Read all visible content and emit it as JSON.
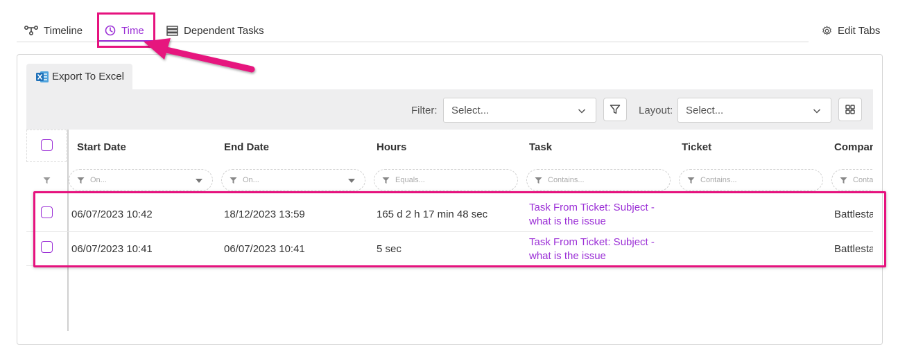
{
  "tabs": {
    "timeline": "Timeline",
    "time": "Time",
    "dependent_tasks": "Dependent Tasks",
    "edit_tabs": "Edit Tabs"
  },
  "toolbar": {
    "export_label": "Export To Excel",
    "filter_label": "Filter:",
    "filter_placeholder": "Select...",
    "layout_label": "Layout:",
    "layout_placeholder": "Select..."
  },
  "table": {
    "columns": [
      "Start Date",
      "End Date",
      "Hours",
      "Task",
      "Ticket",
      "Company"
    ],
    "filters": [
      "On...",
      "On...",
      "Equals...",
      "Contains...",
      "Contains...",
      "Contains..."
    ],
    "rows": [
      {
        "start_date": "06/07/2023 10:42",
        "end_date": "18/12/2023 13:59",
        "hours": "165 d 2 h 17 min 48 sec",
        "task_line1": "Task From Ticket: Subject -",
        "task_line2": "what is the issue",
        "ticket": "",
        "company": "Battlestar"
      },
      {
        "start_date": "06/07/2023 10:41",
        "end_date": "06/07/2023 10:41",
        "hours": "5 sec",
        "task_line1": "Task From Ticket: Subject -",
        "task_line2": "what is the issue",
        "ticket": "",
        "company": "Battlestar"
      }
    ]
  },
  "colors": {
    "accent": "#9b2fd6",
    "annotation": "#e6127e",
    "toolbar_bg": "#eeeeef"
  },
  "icons": [
    "timeline-icon",
    "clock-icon",
    "list-icon",
    "gear-icon",
    "excel-icon",
    "chevron-down-icon",
    "filter-icon",
    "grid-layout-icon"
  ]
}
